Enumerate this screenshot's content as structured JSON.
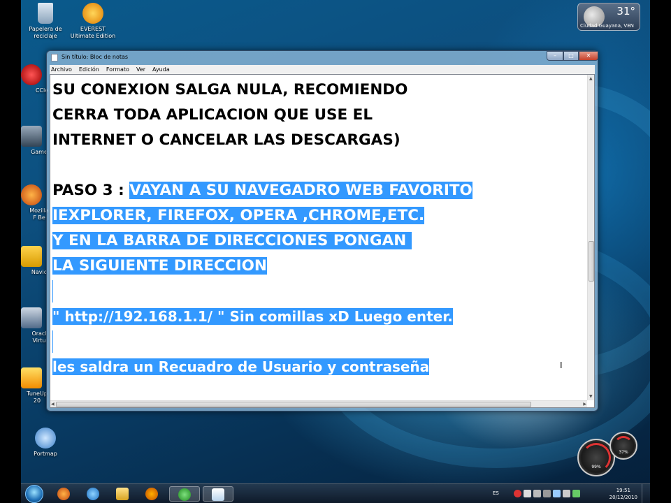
{
  "desktop": {
    "icons": [
      {
        "label": "Papelera de reciclaje",
        "icon": "recycle-bin-icon"
      },
      {
        "label": "EVEREST Ultimate Edition",
        "icon": "everest-icon"
      },
      {
        "label": "CCle",
        "icon": "ccleaner-icon"
      },
      {
        "label": "Game",
        "icon": "game-icon"
      },
      {
        "label": "Mozilla F Be",
        "icon": "firefox-beta-icon"
      },
      {
        "label": "Navic",
        "icon": "navicat-icon"
      },
      {
        "label": "Oracl Virtu",
        "icon": "virtualbox-icon"
      },
      {
        "label": "TuneUp 20",
        "icon": "tuneup-icon"
      },
      {
        "label": "Portmap",
        "icon": "portmap-icon"
      }
    ]
  },
  "weather": {
    "temp": "31°",
    "city": "Ciudad Guayana, VEN"
  },
  "window": {
    "title": "Sin título: Bloc de notas",
    "min": "–",
    "max": "□",
    "close": "✕",
    "menu": [
      "Archivo",
      "Edición",
      "Formato",
      "Ver",
      "Ayuda"
    ]
  },
  "document": {
    "line1": "SU CONEXION SALGA NULA, RECOMIENDO",
    "line2": "CERRA TODA APLICACION QUE USE EL",
    "line3": "INTERNET O CANCELAR LAS DESCARGAS)",
    "line5a": "PASO 3 : ",
    "line5b": "VAYAN A SU NAVEGADRO WEB FAVORITO",
    "line6": "IEXPLORER, FIREFOX, OPERA ,CHROME,ETC.",
    "line7": "Y EN LA BARRA DE DIRECCIONES PONGAN ",
    "line8": "LA SIGUIENTE DIRECCION",
    "line10": "\" http://192.168.1.1/ \" Sin comillas xD Luego enter.",
    "line12": "les saldra un Recuadro de Usuario y contraseña"
  },
  "gauges": {
    "cpu": "99%",
    "mem": "37%"
  },
  "taskbar": {
    "items": [
      "firefox-icon",
      "ie-icon",
      "explorer-icon",
      "media-player-icon",
      "messenger-icon",
      "notepad-icon"
    ],
    "lang": "ES",
    "time": "19:51",
    "date": "20/12/2010"
  },
  "colors": {
    "selection": "#3399ff",
    "title_glass": "#96bedc"
  }
}
